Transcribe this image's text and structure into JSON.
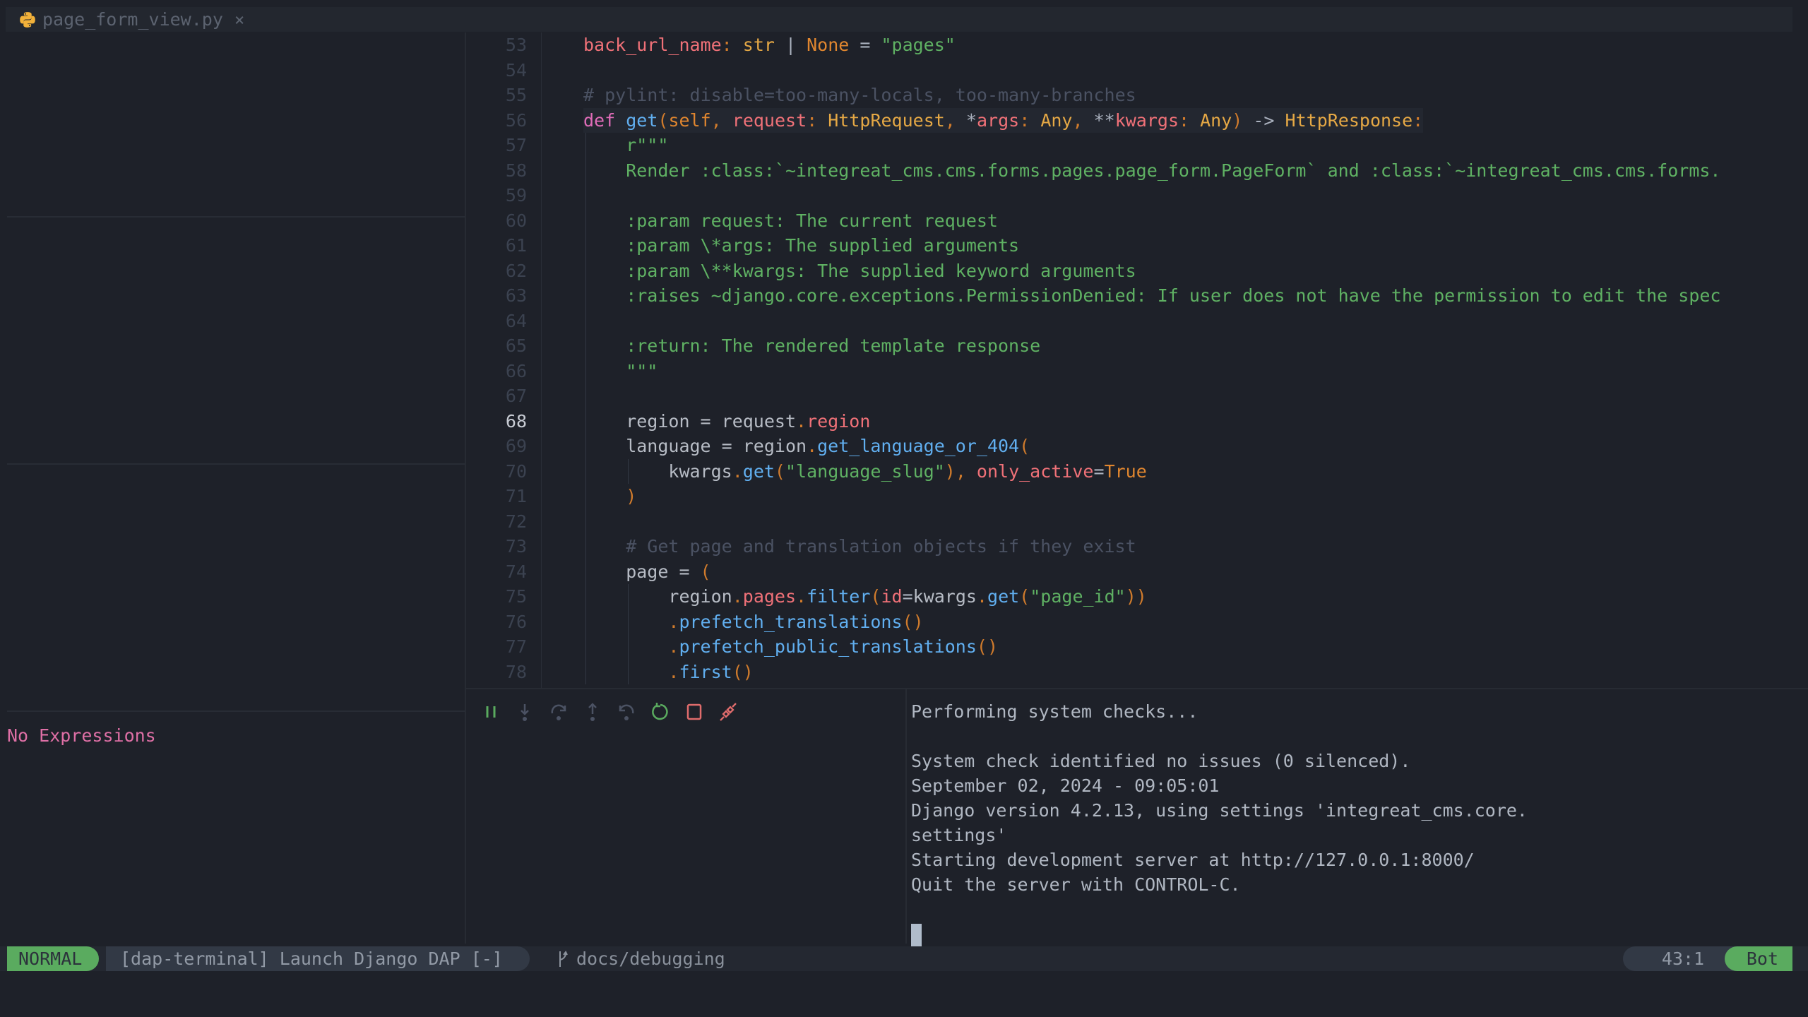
{
  "tab": {
    "filename": "page_form_view.py",
    "icon": "python-icon",
    "close": "×"
  },
  "watches": {
    "empty_text": "No Expressions"
  },
  "code": {
    "current_line": 68,
    "lines": [
      {
        "n": "53",
        "tokens": [
          [
            "var",
            "back_url_name"
          ],
          [
            "pu",
            ": "
          ],
          [
            "ty",
            "str"
          ],
          [
            "op",
            " | "
          ],
          [
            "co",
            "None"
          ],
          [
            "op",
            " = "
          ],
          [
            "str",
            "\"pages\""
          ]
        ],
        "indent": 0
      },
      {
        "n": "54",
        "tokens": [],
        "indent": 0
      },
      {
        "n": "55",
        "tokens": [
          [
            "cm",
            "# pylint: disable=too-many-locals, too-many-branches"
          ]
        ],
        "indent": 0
      },
      {
        "n": "56",
        "tokens": [
          [
            "kw",
            "def "
          ],
          [
            "fn",
            "get"
          ],
          [
            "pu",
            "("
          ],
          [
            "co",
            "self"
          ],
          [
            "pu",
            ", "
          ],
          [
            "var",
            "request"
          ],
          [
            "pu",
            ": "
          ],
          [
            "ty",
            "HttpRequest"
          ],
          [
            "pu",
            ", "
          ],
          [
            "op",
            "*"
          ],
          [
            "var",
            "args"
          ],
          [
            "pu",
            ": "
          ],
          [
            "ty",
            "Any"
          ],
          [
            "pu",
            ", "
          ],
          [
            "op",
            "**"
          ],
          [
            "var",
            "kwargs"
          ],
          [
            "pu",
            ": "
          ],
          [
            "ty",
            "Any"
          ],
          [
            "pu",
            ")"
          ],
          [
            "op",
            " -> "
          ],
          [
            "ty",
            "HttpResponse"
          ],
          [
            "pu",
            ":"
          ]
        ],
        "indent": 0,
        "cursorline": true
      },
      {
        "n": "57",
        "tokens": [
          [
            "doc",
            "r\"\"\""
          ]
        ],
        "indent": 1
      },
      {
        "n": "58",
        "tokens": [
          [
            "doc",
            "Render :class:`~integreat_cms.cms.forms.pages.page_form.PageForm` and :class:`~integreat_cms.cms.forms."
          ]
        ],
        "indent": 1
      },
      {
        "n": "59",
        "tokens": [],
        "indent": 1
      },
      {
        "n": "60",
        "tokens": [
          [
            "doc",
            ":param request: The current request"
          ]
        ],
        "indent": 1
      },
      {
        "n": "61",
        "tokens": [
          [
            "doc",
            ":param \\*args: The supplied arguments"
          ]
        ],
        "indent": 1
      },
      {
        "n": "62",
        "tokens": [
          [
            "doc",
            ":param \\**kwargs: The supplied keyword arguments"
          ]
        ],
        "indent": 1
      },
      {
        "n": "63",
        "tokens": [
          [
            "doc",
            ":raises ~django.core.exceptions.PermissionDenied: If user does not have the permission to edit the spec"
          ]
        ],
        "indent": 1
      },
      {
        "n": "64",
        "tokens": [],
        "indent": 1
      },
      {
        "n": "65",
        "tokens": [
          [
            "doc",
            ":return: The rendered template response"
          ]
        ],
        "indent": 1
      },
      {
        "n": "66",
        "tokens": [
          [
            "doc",
            "\"\"\""
          ]
        ],
        "indent": 1
      },
      {
        "n": "67",
        "tokens": [],
        "indent": 1
      },
      {
        "n": "68",
        "tokens": [
          [
            "pl",
            "region = request"
          ],
          [
            "pu",
            "."
          ],
          [
            "var",
            "region"
          ]
        ],
        "indent": 1
      },
      {
        "n": "69",
        "tokens": [
          [
            "pl",
            "language = region"
          ],
          [
            "pu",
            "."
          ],
          [
            "fn",
            "get_language_or_404"
          ],
          [
            "pu",
            "("
          ]
        ],
        "indent": 1
      },
      {
        "n": "70",
        "tokens": [
          [
            "pl",
            "kwargs"
          ],
          [
            "pu",
            "."
          ],
          [
            "fn",
            "get"
          ],
          [
            "pu",
            "("
          ],
          [
            "str",
            "\"language_slug\""
          ],
          [
            "pu",
            "), "
          ],
          [
            "var",
            "only_active"
          ],
          [
            "op",
            "="
          ],
          [
            "co",
            "True"
          ]
        ],
        "indent": 2
      },
      {
        "n": "71",
        "tokens": [
          [
            "pu",
            ")"
          ]
        ],
        "indent": 1
      },
      {
        "n": "72",
        "tokens": [],
        "indent": 1
      },
      {
        "n": "73",
        "tokens": [
          [
            "cm",
            "# Get page and translation objects if they exist"
          ]
        ],
        "indent": 1
      },
      {
        "n": "74",
        "tokens": [
          [
            "pl",
            "page = "
          ],
          [
            "pu",
            "("
          ]
        ],
        "indent": 1
      },
      {
        "n": "75",
        "tokens": [
          [
            "pl",
            "region"
          ],
          [
            "pu",
            "."
          ],
          [
            "var",
            "pages"
          ],
          [
            "pu",
            "."
          ],
          [
            "fn",
            "filter"
          ],
          [
            "pu",
            "("
          ],
          [
            "var",
            "id"
          ],
          [
            "op",
            "="
          ],
          [
            "pl",
            "kwargs"
          ],
          [
            "pu",
            "."
          ],
          [
            "fn",
            "get"
          ],
          [
            "pu",
            "("
          ],
          [
            "str",
            "\"page_id\""
          ],
          [
            "pu",
            "))"
          ]
        ],
        "indent": 2
      },
      {
        "n": "76",
        "tokens": [
          [
            "pu",
            "."
          ],
          [
            "fn",
            "prefetch_translations"
          ],
          [
            "pu",
            "()"
          ]
        ],
        "indent": 2
      },
      {
        "n": "77",
        "tokens": [
          [
            "pu",
            "."
          ],
          [
            "fn",
            "prefetch_public_translations"
          ],
          [
            "pu",
            "()"
          ]
        ],
        "indent": 2
      },
      {
        "n": "78",
        "tokens": [
          [
            "pu",
            "."
          ],
          [
            "fn",
            "first"
          ],
          [
            "pu",
            "()"
          ]
        ],
        "indent": 2
      }
    ]
  },
  "dap_controls": [
    {
      "name": "pause-icon",
      "label": "Pause",
      "color": "#5aab5f"
    },
    {
      "name": "step-into-icon",
      "label": "Step Into",
      "color": "#4b5263"
    },
    {
      "name": "step-over-icon",
      "label": "Step Over",
      "color": "#4b5263"
    },
    {
      "name": "step-out-icon",
      "label": "Step Out",
      "color": "#4b5263"
    },
    {
      "name": "step-back-icon",
      "label": "Step Back",
      "color": "#4b5263"
    },
    {
      "name": "restart-icon",
      "label": "Restart",
      "color": "#5aab5f"
    },
    {
      "name": "stop-icon",
      "label": "Stop",
      "color": "#e06c6c"
    },
    {
      "name": "disconnect-icon",
      "label": "Disconnect",
      "color": "#e06c6c"
    }
  ],
  "terminal": {
    "lines": [
      "Performing system checks...",
      "",
      "System check identified no issues (0 silenced).",
      "September 02, 2024 - 09:05:01",
      "Django version 4.2.13, using settings 'integreat_cms.core.",
      "settings'",
      "Starting development server at http://127.0.0.1:8000/",
      "Quit the server with CONTROL-C.",
      ""
    ]
  },
  "statusline": {
    "mode": "NORMAL",
    "buffer": "[dap-terminal] Launch Django DAP [-]",
    "branch": "docs/debugging",
    "position": "43:1",
    "scroll": "Bot"
  },
  "colors": {
    "accent_green": "#5aab5f",
    "bg": "#1e2129",
    "pink": "#de6fa5"
  }
}
